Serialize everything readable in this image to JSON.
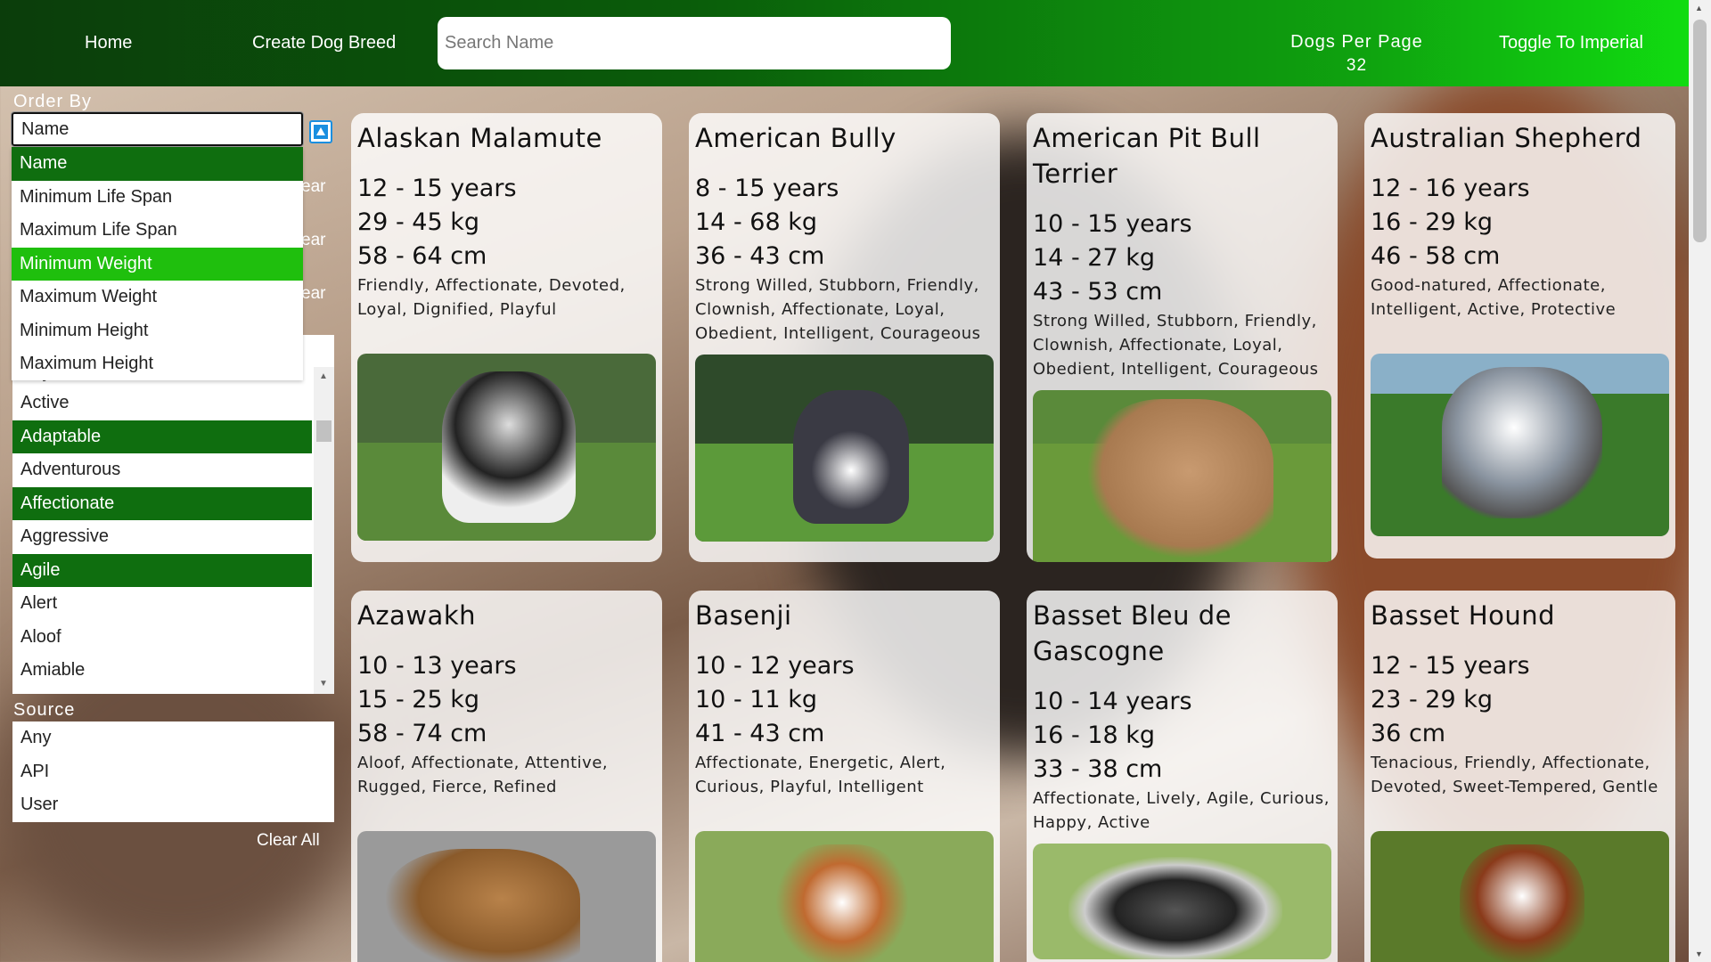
{
  "nav": {
    "home": "Home",
    "create": "Create Dog Breed",
    "search_placeholder": "Search Name",
    "dogs_per_page_label": "Dogs Per Page",
    "dogs_per_page_value": "32",
    "toggle": "Toggle To Imperial"
  },
  "sidebar": {
    "order_by_label": "Order By",
    "order_selected": "Name",
    "order_options": [
      "Name",
      "Minimum Life Span",
      "Maximum Life Span",
      "Minimum Weight",
      "Maximum Weight",
      "Minimum Height",
      "Maximum Height"
    ],
    "clear_partial": "ear",
    "temperament_options": [
      "Any",
      "Active",
      "Adaptable",
      "Adventurous",
      "Affectionate",
      "Aggressive",
      "Agile",
      "Alert",
      "Aloof",
      "Amiable"
    ],
    "source_label": "Source",
    "source_options": [
      "Any",
      "API",
      "User"
    ],
    "clear_all": "Clear All"
  },
  "colors": {
    "selected_dark": "#0f6e0f",
    "selected_bright": "#1fbf0d",
    "nav_start": "#0b3d0b",
    "nav_end": "#11e011"
  },
  "cards": [
    {
      "name": "Alaskan Malamute",
      "life": "12 - 15 years",
      "weight": "29 - 45 kg",
      "height": "58 - 64 cm",
      "temperament": "Friendly, Affectionate, Devoted, Loyal, Dignified, Playful"
    },
    {
      "name": "American Bully",
      "life": "8 - 15 years",
      "weight": "14 - 68 kg",
      "height": "36 - 43 cm",
      "temperament": "Strong Willed, Stubborn, Friendly, Clownish, Affectionate, Loyal, Obedient, Intelligent, Courageous"
    },
    {
      "name": "American Pit Bull Terrier",
      "life": "10 - 15 years",
      "weight": "14 - 27 kg",
      "height": "43 - 53 cm",
      "temperament": "Strong Willed, Stubborn, Friendly, Clownish, Affectionate, Loyal, Obedient, Intelligent, Courageous"
    },
    {
      "name": "Australian Shepherd",
      "life": "12 - 16 years",
      "weight": "16 - 29 kg",
      "height": "46 - 58 cm",
      "temperament": "Good-natured, Affectionate, Intelligent, Active, Protective"
    },
    {
      "name": "Azawakh",
      "life": "10 - 13 years",
      "weight": "15 - 25 kg",
      "height": "58 - 74 cm",
      "temperament": "Aloof, Affectionate, Attentive, Rugged, Fierce, Refined"
    },
    {
      "name": "Basenji",
      "life": "10 - 12 years",
      "weight": "10 - 11 kg",
      "height": "41 - 43 cm",
      "temperament": "Affectionate, Energetic, Alert, Curious, Playful, Intelligent"
    },
    {
      "name": "Basset Bleu de Gascogne",
      "life": "10 - 14 years",
      "weight": "16 - 18 kg",
      "height": "33 - 38 cm",
      "temperament": "Affectionate, Lively, Agile, Curious, Happy, Active"
    },
    {
      "name": "Basset Hound",
      "life": "12 - 15 years",
      "weight": "23 - 29 kg",
      "height": "36 cm",
      "temperament": "Tenacious, Friendly, Affectionate, Devoted, Sweet-Tempered, Gentle"
    }
  ]
}
